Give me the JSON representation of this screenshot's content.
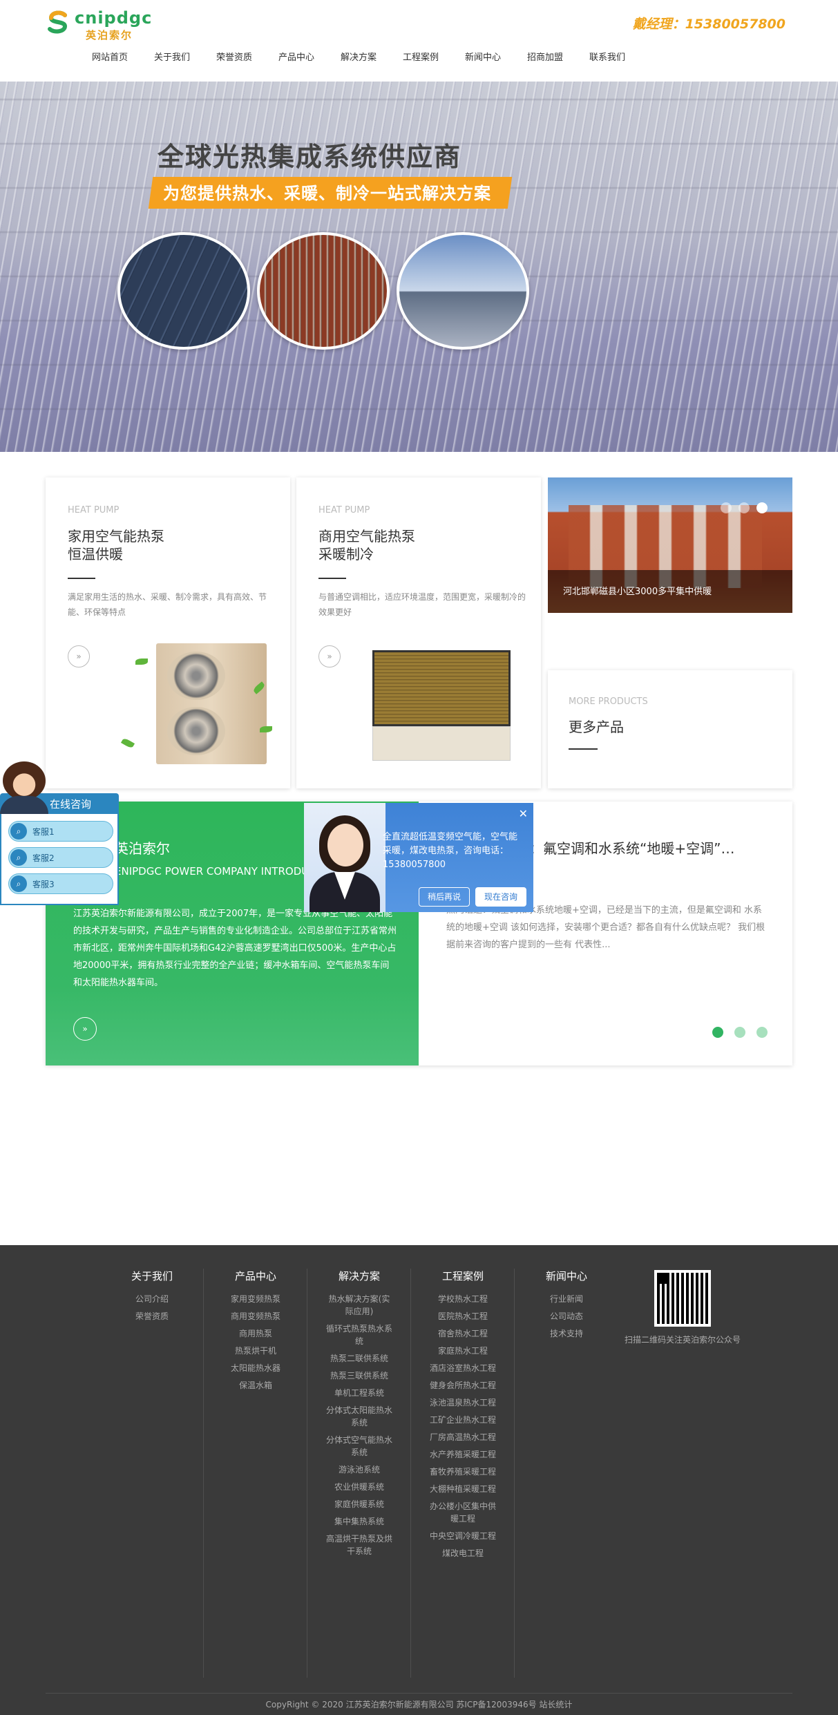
{
  "header": {
    "logo_text": "cnipdgc",
    "logo_sub": "英泊索尔",
    "hotline": "戴经理：15380057800"
  },
  "nav": [
    "网站首页",
    "关于我们",
    "荣誉资质",
    "产品中心",
    "解决方案",
    "工程案例",
    "新闻中心",
    "招商加盟",
    "联系我们"
  ],
  "banner": {
    "title": "全球光热集成系统供应商",
    "subtitle": "为您提供热水、采暖、制冷一站式解决方案"
  },
  "products": [
    {
      "en": "HEAT PUMP",
      "title_line1": "家用空气能热泵",
      "title_line2": "恒温供暖",
      "desc": "满足家用生活的热水、采暖、制冷需求，具有高效、节能、环保等特点",
      "arrow": "»"
    },
    {
      "en": "HEAT PUMP",
      "title_line1": "商用空气能热泵",
      "title_line2": "采暖制冷",
      "desc": "与普通空调相比，适应环境温度，范围更宽，采暖制冷的效果更好",
      "arrow": "»"
    }
  ],
  "slide": {
    "caption": "河北邯郸磁县小区3000多平集中供暖"
  },
  "more": {
    "en": "MORE PRODUCTS",
    "title": "更多产品"
  },
  "about": {
    "title": "英泊索尔",
    "en": "ENIPDGC POWER COMPANY INTRODUCTION",
    "text": "江苏英泊索尔新能源有限公司，成立于2007年，是一家专业从事空气能、太阳能的技术开发与研究，产品生产与销售的专业化制造企业。公司总部位于江苏省常州市新北区，距常州奔牛国际机场和G42沪蓉高速罗墅湾出口仅500米。生产中心占地20000平米，拥有热泵行业完整的全产业链；缓冲水箱车间、空气能热泵车间和太阳能热水器车间。",
    "arrow": "»"
  },
  "news": {
    "title": "热门话题：氟空调和水系统“地暖+空调”…",
    "text": "热门话题：氟空调和水系统地暖+空调，已经是当下的主流，但是氟空调和 水系统的地暖+空调 该如何选择，安装哪个更合适？都各自有什么优缺点呢？ 我们根据前来咨询的客户提到的一些有 代表性..."
  },
  "consult": {
    "title": "在线咨询",
    "services": [
      "客服1",
      "客服2",
      "客服3"
    ],
    "service_icon": "⌕"
  },
  "popup": {
    "text": "全直流超低温变频空气能，空气能采暖，煤改电热泵，咨询电话：15380057800",
    "later": "稍后再说",
    "now": "现在咨询",
    "close": "✕"
  },
  "footer": {
    "columns": [
      {
        "title": "关于我们",
        "links": [
          "公司介绍",
          "荣誉资质"
        ]
      },
      {
        "title": "产品中心",
        "links": [
          "家用变频热泵",
          "商用变频热泵",
          "商用热泵",
          "热泵烘干机",
          "太阳能热水器",
          "保温水箱"
        ]
      },
      {
        "title": "解决方案",
        "links": [
          "热水解决方案(实际应用)",
          "循环式热泵热水系统",
          "热泵二联供系统",
          "热泵三联供系统",
          "单机工程系统",
          "分体式太阳能热水系统",
          "分体式空气能热水系统",
          "游泳池系统",
          "农业供暖系统",
          "家庭供暖系统",
          "集中集热系统",
          "高温烘干热泵及烘干系统"
        ]
      },
      {
        "title": "工程案例",
        "links": [
          "学校热水工程",
          "医院热水工程",
          "宿舍热水工程",
          "家庭热水工程",
          "酒店浴室热水工程",
          "健身会所热水工程",
          "泳池温泉热水工程",
          "工矿企业热水工程",
          "厂房高温热水工程",
          "水产养殖采暖工程",
          "畜牧养殖采暖工程",
          "大棚种植采暖工程",
          "办公楼小区集中供暖工程",
          "中央空调冷暖工程",
          "煤改电工程"
        ]
      },
      {
        "title": "新闻中心",
        "links": [
          "行业新闻",
          "公司动态",
          "技术支持"
        ]
      }
    ],
    "qr_caption": "扫描二维码关注英泊索尔公众号",
    "copyright": "CopyRight © 2020 江苏英泊索尔新能源有限公司 苏ICP备12003946号  站长统计"
  }
}
